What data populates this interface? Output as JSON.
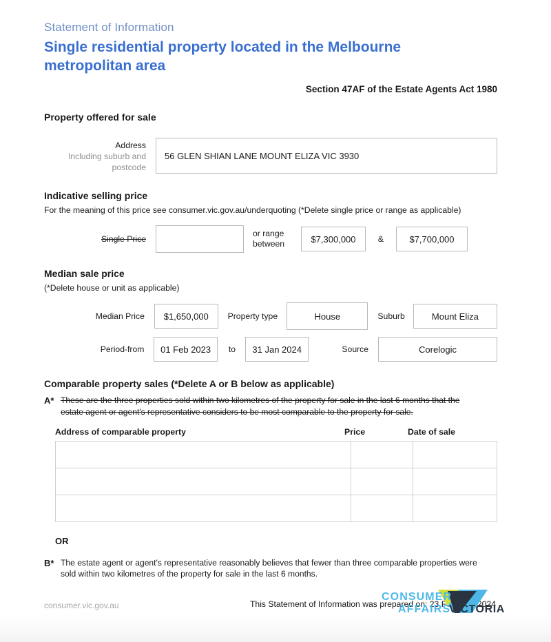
{
  "header": {
    "subtitle": "Statement of Information",
    "title": "Single residential property located in the Melbourne metropolitan area",
    "act_reference": "Section 47AF of the Estate Agents Act 1980"
  },
  "property_offered": {
    "heading": "Property offered for sale",
    "address_label_line1": "Address",
    "address_label_line2": "Including suburb and postcode",
    "address_value": "56 GLEN SHIAN LANE MOUNT ELIZA VIC 3930",
    "address_placeholder": "Address including suburb and postcode"
  },
  "indicative_price": {
    "heading": "Indicative selling price",
    "note": "For the meaning of this price see consumer.vic.gov.au/underquoting (*Delete single price or range as applicable)",
    "single_price_label": "Single Price",
    "single_price_value": "",
    "single_price_placeholder": "",
    "or_range_label": "or range between",
    "range_low": "$7,300,000",
    "ampersand": "&",
    "range_high": "$7,700,000"
  },
  "median_price": {
    "heading": "Median sale price",
    "note": "(*Delete house or unit as applicable)",
    "median_price_label": "Median Price",
    "median_price_value": "$1,650,000",
    "property_type_label": "Property type",
    "property_type_value": "House",
    "suburb_label": "Suburb",
    "suburb_value": "Mount Eliza",
    "period_from_label": "Period-from",
    "period_from_value": "01 Feb 2023",
    "to_label": "to",
    "period_to_value": "31 Jan 2024",
    "source_label": "Source",
    "source_value": "Corelogic"
  },
  "comparable_sales": {
    "heading": "Comparable property sales (*Delete A or B below as applicable)",
    "option_a_mark": "A*",
    "option_a_text": "These are the three properties sold within two kilometres of the property for sale in the last 6 months that the estate agent or agent's representative considers to be most comparable to the property for sale.",
    "columns": [
      "Address of comparable property",
      "Price",
      "Date of sale"
    ],
    "rows": [
      {
        "address": "",
        "price": "",
        "date_of_sale": ""
      },
      {
        "address": "",
        "price": "",
        "date_of_sale": ""
      },
      {
        "address": "",
        "price": "",
        "date_of_sale": ""
      }
    ],
    "or_label": "OR",
    "option_b_mark": "B*",
    "option_b_text": "The estate agent or agent's representative reasonably believes that fewer than three comparable properties were sold within two kilometres of the property for sale in the last 6 months."
  },
  "prepared": {
    "text": "This Statement of Information was prepared on: 23 February 2024"
  },
  "footer": {
    "url": "consumer.vic.gov.au",
    "logo_line1": "CONSUMER",
    "logo_line2": "AFFAIRS",
    "logo_word": "VICTORIA"
  },
  "colors": {
    "subtitle_blue": "#6f8fc4",
    "title_blue": "#3a6fd0",
    "logo_light_blue": "#4db8e8",
    "logo_navy": "#2a3340",
    "logo_yellow": "#d2e03c",
    "box_border": "#b9b9b9",
    "table_border": "#cfcfcf",
    "muted_text": "#8d8d8d"
  }
}
